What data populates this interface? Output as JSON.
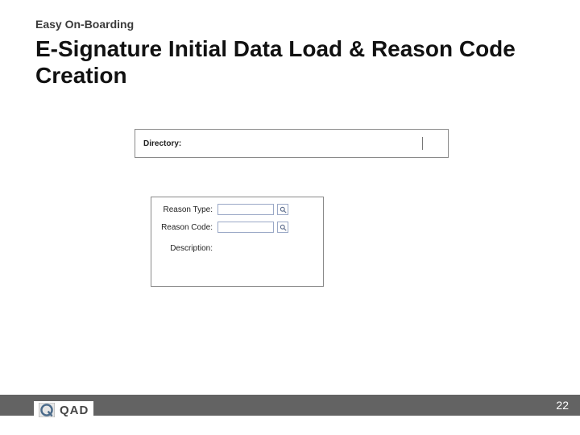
{
  "pretitle": "Easy On-Boarding",
  "title": "E-Signature Initial Data Load & Reason Code Creation",
  "panel1": {
    "directory_label": "Directory:",
    "directory_value": ""
  },
  "panel2": {
    "reason_type_label": "Reason Type:",
    "reason_type_value": "",
    "reason_code_label": "Reason Code:",
    "reason_code_value": "",
    "description_label": "Description:"
  },
  "logo": {
    "text": "QAD"
  },
  "page_number": "22"
}
